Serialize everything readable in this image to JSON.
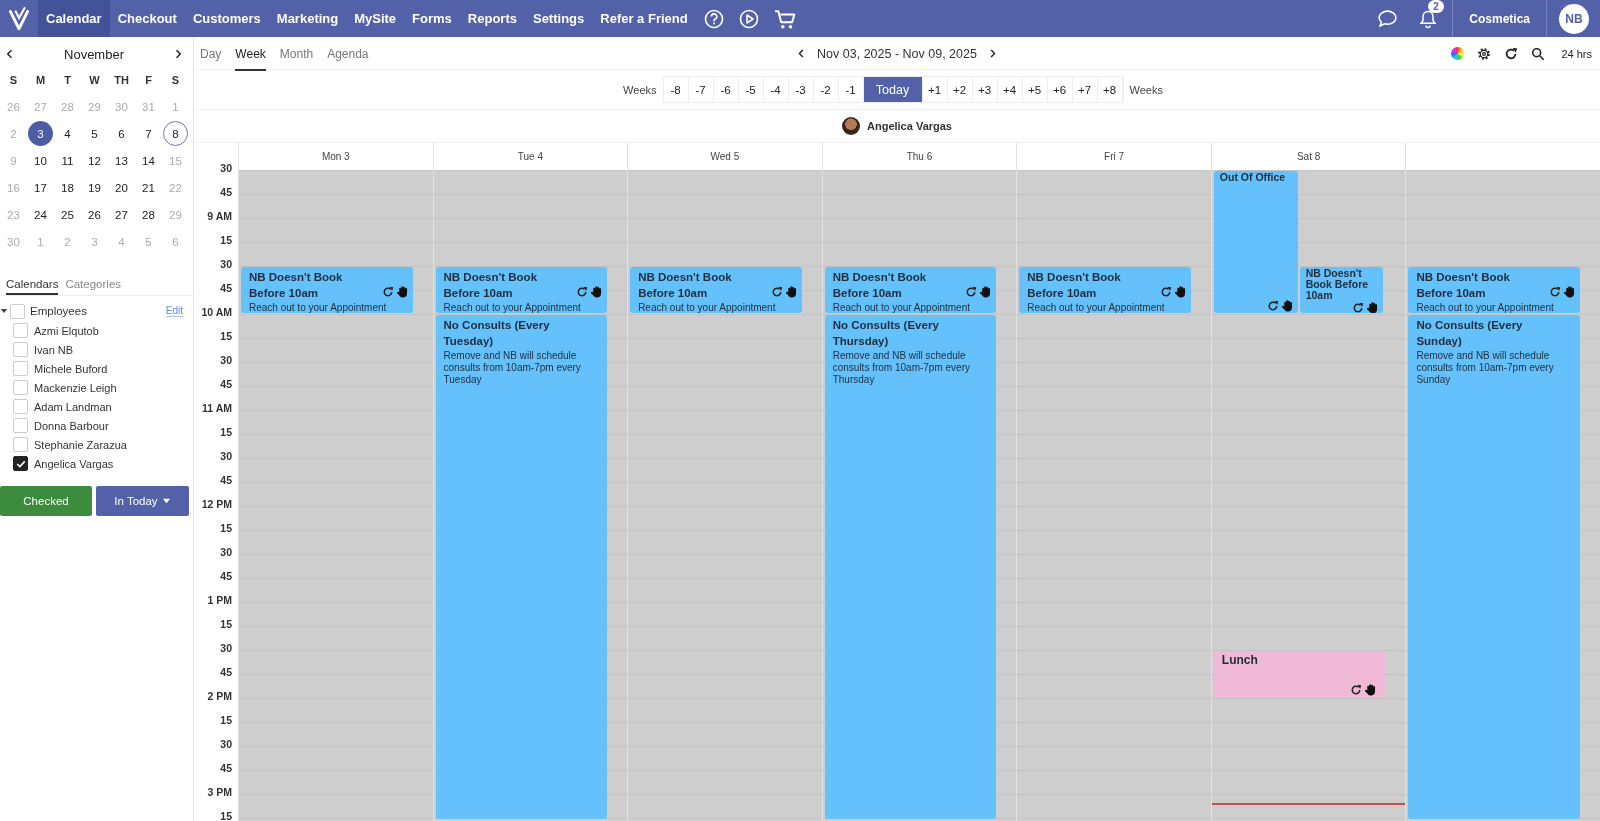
{
  "nav": {
    "items": [
      {
        "label": "Calendar",
        "selected": true
      },
      {
        "label": "Checkout",
        "selected": false
      },
      {
        "label": "Customers",
        "selected": false
      },
      {
        "label": "Marketing",
        "selected": false
      },
      {
        "label": "MySite",
        "selected": false
      },
      {
        "label": "Forms",
        "selected": false
      },
      {
        "label": "Reports",
        "selected": false
      },
      {
        "label": "Settings",
        "selected": false
      },
      {
        "label": "Refer a Friend",
        "selected": false
      }
    ],
    "notifications": "2",
    "account": "Cosmetica",
    "avatar": "NB"
  },
  "mini_calendar": {
    "month": "November",
    "weekdays": [
      "S",
      "M",
      "T",
      "W",
      "TH",
      "F",
      "S"
    ],
    "days": [
      {
        "label": "26",
        "muted": true,
        "selected": false,
        "today": false
      },
      {
        "label": "27",
        "muted": true,
        "selected": false,
        "today": false
      },
      {
        "label": "28",
        "muted": true,
        "selected": false,
        "today": false
      },
      {
        "label": "29",
        "muted": true,
        "selected": false,
        "today": false
      },
      {
        "label": "30",
        "muted": true,
        "selected": false,
        "today": false
      },
      {
        "label": "31",
        "muted": true,
        "selected": false,
        "today": false
      },
      {
        "label": "1",
        "muted": true,
        "selected": false,
        "today": false
      },
      {
        "label": "2",
        "muted": true,
        "selected": false,
        "today": false
      },
      {
        "label": "3",
        "muted": false,
        "selected": true,
        "today": false
      },
      {
        "label": "4",
        "muted": false,
        "selected": false,
        "today": false
      },
      {
        "label": "5",
        "muted": false,
        "selected": false,
        "today": false
      },
      {
        "label": "6",
        "muted": false,
        "selected": false,
        "today": false
      },
      {
        "label": "7",
        "muted": false,
        "selected": false,
        "today": false
      },
      {
        "label": "8",
        "muted": false,
        "selected": false,
        "today": true
      },
      {
        "label": "9",
        "muted": true,
        "selected": false,
        "today": false
      },
      {
        "label": "10",
        "muted": false,
        "selected": false,
        "today": false
      },
      {
        "label": "11",
        "muted": false,
        "selected": false,
        "today": false
      },
      {
        "label": "12",
        "muted": false,
        "selected": false,
        "today": false
      },
      {
        "label": "13",
        "muted": false,
        "selected": false,
        "today": false
      },
      {
        "label": "14",
        "muted": false,
        "selected": false,
        "today": false
      },
      {
        "label": "15",
        "muted": true,
        "selected": false,
        "today": false
      },
      {
        "label": "16",
        "muted": true,
        "selected": false,
        "today": false
      },
      {
        "label": "17",
        "muted": false,
        "selected": false,
        "today": false
      },
      {
        "label": "18",
        "muted": false,
        "selected": false,
        "today": false
      },
      {
        "label": "19",
        "muted": false,
        "selected": false,
        "today": false
      },
      {
        "label": "20",
        "muted": false,
        "selected": false,
        "today": false
      },
      {
        "label": "21",
        "muted": false,
        "selected": false,
        "today": false
      },
      {
        "label": "22",
        "muted": true,
        "selected": false,
        "today": false
      },
      {
        "label": "23",
        "muted": true,
        "selected": false,
        "today": false
      },
      {
        "label": "24",
        "muted": false,
        "selected": false,
        "today": false
      },
      {
        "label": "25",
        "muted": false,
        "selected": false,
        "today": false
      },
      {
        "label": "26",
        "muted": false,
        "selected": false,
        "today": false
      },
      {
        "label": "27",
        "muted": false,
        "selected": false,
        "today": false
      },
      {
        "label": "28",
        "muted": false,
        "selected": false,
        "today": false
      },
      {
        "label": "29",
        "muted": true,
        "selected": false,
        "today": false
      },
      {
        "label": "30",
        "muted": true,
        "selected": false,
        "today": false
      },
      {
        "label": "1",
        "muted": true,
        "selected": false,
        "today": false
      },
      {
        "label": "2",
        "muted": true,
        "selected": false,
        "today": false
      },
      {
        "label": "3",
        "muted": true,
        "selected": false,
        "today": false
      },
      {
        "label": "4",
        "muted": true,
        "selected": false,
        "today": false
      },
      {
        "label": "5",
        "muted": true,
        "selected": false,
        "today": false
      },
      {
        "label": "6",
        "muted": true,
        "selected": false,
        "today": false
      }
    ]
  },
  "sidebar_tabs": [
    {
      "label": "Calendars",
      "selected": true
    },
    {
      "label": "Categories",
      "selected": false
    }
  ],
  "calendars": {
    "label": "Employees",
    "checked": false,
    "expanded": true,
    "edit": "Edit",
    "children": [
      {
        "label": "Azmi Elqutob",
        "checked": false
      },
      {
        "label": "Ivan NB",
        "checked": false
      },
      {
        "label": "Michele Buford",
        "checked": false
      },
      {
        "label": "Mackenzie Leigh",
        "checked": false
      },
      {
        "label": "Adam Landman",
        "checked": false
      },
      {
        "label": "Donna Barbour",
        "checked": false
      },
      {
        "label": "Stephanie Zarazua",
        "checked": false
      },
      {
        "label": "Angelica Vargas",
        "checked": true
      }
    ]
  },
  "buttons": [
    {
      "label": "Checked",
      "kind": "success"
    },
    {
      "label": "In Today",
      "kind": "dropdown"
    }
  ],
  "views": [
    {
      "label": "Day",
      "selected": false
    },
    {
      "label": "Week",
      "selected": true
    },
    {
      "label": "Month",
      "selected": false
    },
    {
      "label": "Agenda",
      "selected": false
    }
  ],
  "date_range": "Nov 03, 2025 - Nov 09, 2025",
  "hours_option": "24 hrs",
  "week_jump": {
    "label_before": "Weeks",
    "label_after": "Weeks",
    "items": [
      {
        "label": "-8",
        "selected": false
      },
      {
        "label": "-7",
        "selected": false
      },
      {
        "label": "-6",
        "selected": false
      },
      {
        "label": "-5",
        "selected": false
      },
      {
        "label": "-4",
        "selected": false
      },
      {
        "label": "-3",
        "selected": false
      },
      {
        "label": "-2",
        "selected": false
      },
      {
        "label": "-1",
        "selected": false
      },
      {
        "label": "Today",
        "selected": true
      },
      {
        "label": "+1",
        "selected": false
      },
      {
        "label": "+2",
        "selected": false
      },
      {
        "label": "+3",
        "selected": false
      },
      {
        "label": "+4",
        "selected": false
      },
      {
        "label": "+5",
        "selected": false
      },
      {
        "label": "+6",
        "selected": false
      },
      {
        "label": "+7",
        "selected": false
      },
      {
        "label": "+8",
        "selected": false
      }
    ]
  },
  "resource": {
    "name": "Angelica Vargas"
  },
  "time_labels": [
    "30",
    "45",
    "9 AM",
    "15",
    "30",
    "45",
    "10 AM",
    "15",
    "30",
    "45",
    "11 AM",
    "15",
    "30",
    "45",
    "12 PM",
    "15",
    "30",
    "45",
    "1 PM",
    "15",
    "30",
    "45",
    "2 PM",
    "15",
    "30",
    "45",
    "3 PM",
    "15"
  ],
  "days": [
    {
      "label": "Mon 3",
      "lanes": [
        [
          {
            "kind": "empty"
          },
          {
            "kind": "empty"
          },
          {
            "kind": "empty"
          },
          {
            "kind": "empty"
          },
          {
            "kind": "event",
            "title": "NB Doesn't Book Before 10am",
            "description": "Reach out to your Appointment",
            "color": "#64c1fb",
            "actions": true
          },
          {
            "kind": "continued"
          }
        ]
      ]
    },
    {
      "label": "Tue 4",
      "lanes": [
        [
          {
            "kind": "empty"
          },
          {
            "kind": "empty"
          },
          {
            "kind": "empty"
          },
          {
            "kind": "empty"
          },
          {
            "kind": "event",
            "title": "NB Doesn't Book Before 10am",
            "description": "Reach out to your Appointment",
            "color": "#64c1fb",
            "actions": true
          },
          {
            "kind": "continued"
          },
          {
            "kind": "event",
            "title": "No Consults (Every Tuesday)",
            "description": "Remove and NB will schedule consults from 10am-7pm every Tuesday",
            "color": "#64c1fb",
            "actions": false
          },
          {
            "kind": "continued"
          },
          {
            "kind": "continued"
          },
          {
            "kind": "continued"
          },
          {
            "kind": "continued"
          },
          {
            "kind": "continued"
          },
          {
            "kind": "continued"
          },
          {
            "kind": "continued"
          },
          {
            "kind": "continued"
          },
          {
            "kind": "continued"
          },
          {
            "kind": "continued"
          },
          {
            "kind": "continued"
          },
          {
            "kind": "continued"
          },
          {
            "kind": "continued"
          },
          {
            "kind": "continued"
          },
          {
            "kind": "continued"
          },
          {
            "kind": "continued"
          },
          {
            "kind": "continued"
          },
          {
            "kind": "continued"
          },
          {
            "kind": "continued"
          },
          {
            "kind": "continued"
          }
        ]
      ]
    },
    {
      "label": "Wed 5",
      "lanes": [
        [
          {
            "kind": "empty"
          },
          {
            "kind": "empty"
          },
          {
            "kind": "empty"
          },
          {
            "kind": "empty"
          },
          {
            "kind": "event",
            "title": "NB Doesn't Book Before 10am",
            "description": "Reach out to your Appointment",
            "color": "#64c1fb",
            "actions": true
          },
          {
            "kind": "continued"
          }
        ]
      ]
    },
    {
      "label": "Thu 6",
      "lanes": [
        [
          {
            "kind": "empty"
          },
          {
            "kind": "empty"
          },
          {
            "kind": "empty"
          },
          {
            "kind": "empty"
          },
          {
            "kind": "event",
            "title": "NB Doesn't Book Before 10am",
            "description": "Reach out to your Appointment",
            "color": "#64c1fb",
            "actions": true
          },
          {
            "kind": "continued"
          },
          {
            "kind": "event",
            "title": "No Consults (Every Thursday)",
            "description": "Remove and NB will schedule consults from 10am-7pm every Thursday",
            "color": "#64c1fb",
            "actions": false
          },
          {
            "kind": "continued"
          },
          {
            "kind": "continued"
          },
          {
            "kind": "continued"
          },
          {
            "kind": "continued"
          },
          {
            "kind": "continued"
          },
          {
            "kind": "continued"
          },
          {
            "kind": "continued"
          },
          {
            "kind": "continued"
          },
          {
            "kind": "continued"
          },
          {
            "kind": "continued"
          },
          {
            "kind": "continued"
          },
          {
            "kind": "continued"
          },
          {
            "kind": "continued"
          },
          {
            "kind": "continued"
          },
          {
            "kind": "continued"
          },
          {
            "kind": "continued"
          },
          {
            "kind": "continued"
          },
          {
            "kind": "continued"
          },
          {
            "kind": "continued"
          },
          {
            "kind": "continued"
          }
        ]
      ]
    },
    {
      "label": "Fri 7",
      "lanes": [
        [
          {
            "kind": "empty"
          },
          {
            "kind": "empty"
          },
          {
            "kind": "empty"
          },
          {
            "kind": "empty"
          },
          {
            "kind": "event",
            "title": "NB Doesn't Book Before 10am",
            "description": "Reach out to your Appointment",
            "color": "#64c1fb",
            "actions": true
          },
          {
            "kind": "continued"
          }
        ]
      ]
    },
    {
      "label": "Sat 8",
      "lanes": [
        [
          {
            "kind": "event",
            "title": "Out Of Office",
            "color": "#64c1fb",
            "actions": true
          },
          {
            "kind": "continued"
          },
          {
            "kind": "continued"
          },
          {
            "kind": "continued"
          },
          {
            "kind": "continued"
          },
          {
            "kind": "continued"
          },
          {
            "kind": "empty"
          },
          {
            "kind": "empty"
          },
          {
            "kind": "empty"
          },
          {
            "kind": "empty"
          },
          {
            "kind": "empty"
          },
          {
            "kind": "empty"
          },
          {
            "kind": "empty"
          },
          {
            "kind": "empty"
          },
          {
            "kind": "empty"
          },
          {
            "kind": "empty"
          },
          {
            "kind": "empty"
          },
          {
            "kind": "empty"
          },
          {
            "kind": "empty"
          },
          {
            "kind": "empty"
          },
          {
            "kind": "event",
            "title": "Lunch",
            "color": "#f0b9d6",
            "actions": true
          },
          {
            "kind": "continued"
          },
          {
            "kind": "empty"
          },
          {
            "kind": "empty"
          },
          {
            "kind": "empty"
          },
          {
            "kind": "empty"
          },
          {
            "kind": "now"
          }
        ],
        [
          {
            "kind": "empty"
          },
          {
            "kind": "empty"
          },
          {
            "kind": "empty"
          },
          {
            "kind": "empty"
          },
          {
            "kind": "event",
            "title": "NB Doesn't Book Before 10am",
            "color": "#64c1fb",
            "actions": true
          },
          {
            "kind": "continued"
          }
        ]
      ]
    },
    {
      "lanes": [
        [
          {
            "kind": "empty"
          },
          {
            "kind": "empty"
          },
          {
            "kind": "empty"
          },
          {
            "kind": "empty"
          },
          {
            "kind": "event",
            "title": "NB Doesn't Book Before 10am",
            "description": "Reach out to your Appointment",
            "color": "#64c1fb",
            "actions": true
          },
          {
            "kind": "continued"
          },
          {
            "kind": "event",
            "title": "No Consults (Every Sunday)",
            "description": "Remove and NB will schedule consults from 10am-7pm every Sunday",
            "color": "#64c1fb",
            "actions": false
          },
          {
            "kind": "continued"
          },
          {
            "kind": "continued"
          },
          {
            "kind": "continued"
          },
          {
            "kind": "continued"
          },
          {
            "kind": "continued"
          },
          {
            "kind": "continued"
          },
          {
            "kind": "continued"
          },
          {
            "kind": "continued"
          },
          {
            "kind": "continued"
          },
          {
            "kind": "continued"
          },
          {
            "kind": "continued"
          },
          {
            "kind": "continued"
          },
          {
            "kind": "continued"
          },
          {
            "kind": "continued"
          },
          {
            "kind": "continued"
          },
          {
            "kind": "continued"
          },
          {
            "kind": "continued"
          },
          {
            "kind": "continued"
          },
          {
            "kind": "continued"
          },
          {
            "kind": "continued"
          }
        ]
      ]
    }
  ]
}
